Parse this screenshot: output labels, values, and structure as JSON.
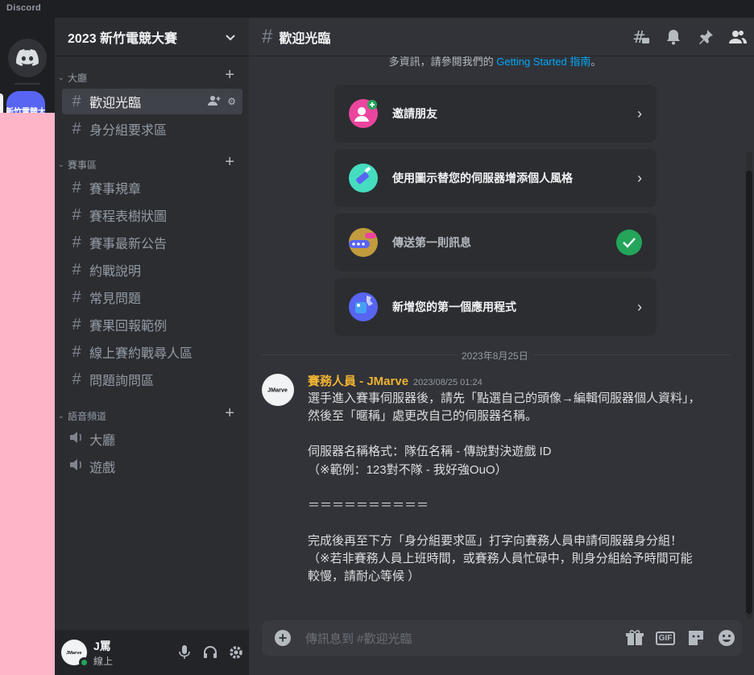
{
  "window": {
    "title": "Discord"
  },
  "rail": {
    "server_label": "新竹電競大"
  },
  "server": {
    "name": "2023 新竹電競大賽"
  },
  "categories": [
    {
      "label": "大廳"
    },
    {
      "label": "賽事區"
    },
    {
      "label": "語音頻道"
    }
  ],
  "channels": {
    "lobby": [
      {
        "label": "歡迎光臨"
      },
      {
        "label": "身分組要求區"
      }
    ],
    "event": [
      {
        "label": "賽事規章"
      },
      {
        "label": "賽程表樹狀圖"
      },
      {
        "label": "賽事最新公告"
      },
      {
        "label": "約戰說明"
      },
      {
        "label": "常見問題"
      },
      {
        "label": "賽果回報範例"
      },
      {
        "label": "線上賽約戰尋人區"
      },
      {
        "label": "問題詢問區"
      }
    ],
    "voice": [
      {
        "label": "大廳"
      },
      {
        "label": "遊戲"
      }
    ]
  },
  "user": {
    "name": "J罵",
    "status": "線上",
    "avatar_text": "JMarve",
    "status_color": "#23a55a"
  },
  "main": {
    "channel_name": "歡迎光臨"
  },
  "intro": {
    "text": "多資訊，請參閱我們的 ",
    "link": "Getting Started 指南",
    "suffix": "。"
  },
  "actions": [
    {
      "label": "邀請朋友",
      "icon": "invite-friends-icon",
      "color": "#eb459e"
    },
    {
      "label": "使用圖示替您的伺服器增添個人風格",
      "icon": "paintbrush-icon",
      "color": "#45ddc0"
    },
    {
      "label": "傳送第一則訊息",
      "icon": "message-bubble-icon",
      "color": "#c29b3c",
      "done": true
    },
    {
      "label": "新增您的第一個應用程式",
      "icon": "app-wrench-icon",
      "color": "#5865f2"
    }
  ],
  "date_divider": "2023年8月25日",
  "message": {
    "author": "賽務人員 - JMarve",
    "timestamp": "2023/08/25 01:24",
    "avatar_text": "JMarve",
    "paragraphs": [
      "選手進入賽事伺服器後，請先「點選自己的頭像→編輯伺服器個人資料」，然後至「暱稱」處更改自己的伺服器名稱。",
      "",
      "伺服器名稱格式：隊伍名稱 - 傳說對決遊戲 ID\n（※範例：123對不隊 - 我好強OuO）",
      "",
      "＝＝＝＝＝＝＝＝＝＝",
      "",
      "完成後再至下方「身分組要求區」打字向賽務人員申請伺服器身分組！\n（※若非賽務人員上班時間，或賽務人員忙碌中，則身分組給予時間可能較慢，請耐心等候 ）"
    ]
  },
  "composer": {
    "placeholder": "傳訊息到 #歡迎光臨",
    "gif_label": "GIF"
  },
  "colors": {
    "accent": "#5865f2",
    "online": "#23a55a",
    "link": "#00a8fc",
    "author": "#f0b232",
    "rail_bg": "#ffb5c8"
  }
}
